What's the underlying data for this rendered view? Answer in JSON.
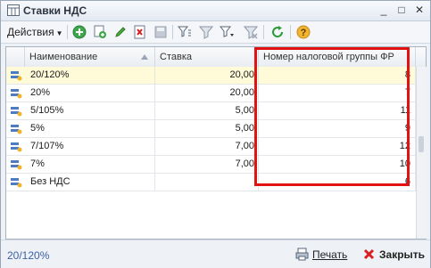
{
  "window": {
    "title": "Ставки НДС",
    "minimize": "_",
    "maximize": "□",
    "close": "✕"
  },
  "toolbar": {
    "actions_label": "Действия"
  },
  "table": {
    "columns": [
      "Наименование",
      "Ставка",
      "Номер налоговой группы ФР"
    ],
    "rows": [
      {
        "name": "20/120%",
        "rate": "20,00",
        "group": "8"
      },
      {
        "name": "20%",
        "rate": "20,00",
        "group": "7"
      },
      {
        "name": "5/105%",
        "rate": "5,00",
        "group": "11"
      },
      {
        "name": "5%",
        "rate": "5,00",
        "group": "9"
      },
      {
        "name": "7/107%",
        "rate": "7,00",
        "group": "12"
      },
      {
        "name": "7%",
        "rate": "7,00",
        "group": "10"
      },
      {
        "name": "Без НДС",
        "rate": "",
        "group": "6"
      }
    ]
  },
  "footer": {
    "status": "20/120%",
    "print_label": "Печать",
    "close_label": "Закрыть"
  },
  "colors": {
    "highlight": "#e31212",
    "selected_row": "#fffbd9",
    "status_text": "#3b5fa3"
  }
}
